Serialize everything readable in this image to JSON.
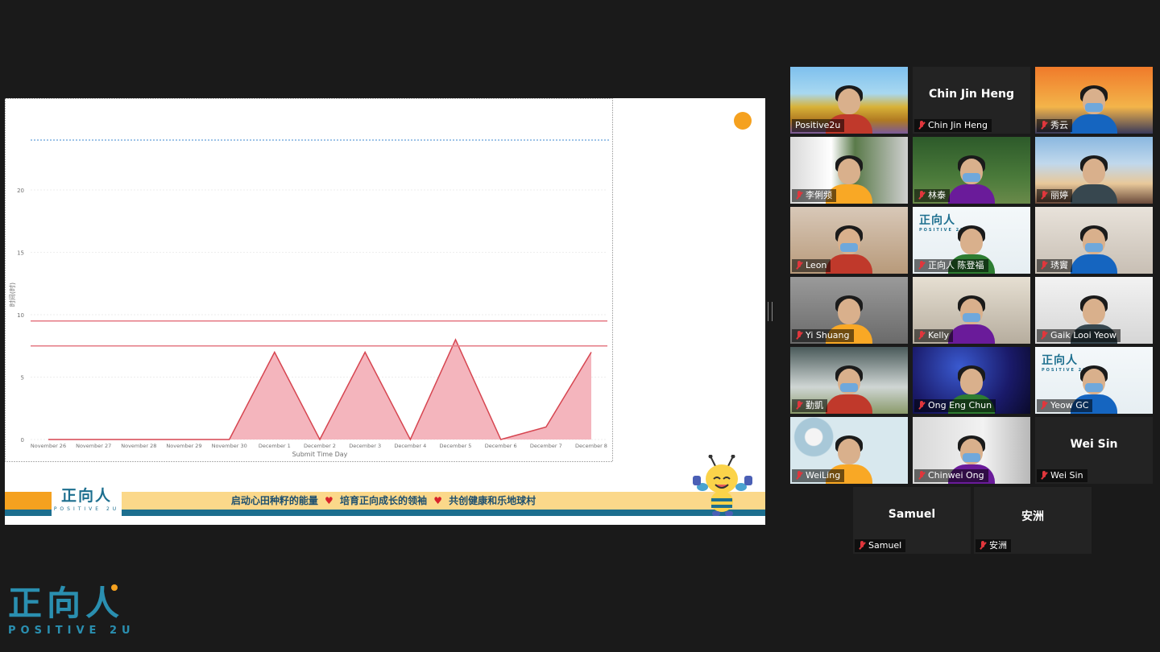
{
  "slide": {
    "banner_logo_zh": "正向人",
    "banner_logo_en": "POSITIVE 2U",
    "banner_phrases": [
      "启动心田种籽的能量",
      "培育正向成长的领袖",
      "共创健康和乐地球村"
    ]
  },
  "chart_data": {
    "type": "area",
    "xlabel": "Submit Time Day",
    "ylabel": "时间(时)",
    "categories": [
      "November 26",
      "November 27",
      "November 28",
      "November 29",
      "November 30",
      "December 1",
      "December 2",
      "December 3",
      "December 4",
      "December 5",
      "December 6",
      "December 7",
      "December 8"
    ],
    "series": [
      {
        "values": [
          0,
          0,
          0,
          0,
          0,
          7,
          0,
          7,
          0,
          8,
          0,
          1,
          7
        ]
      }
    ],
    "yticks": [
      0,
      5,
      10,
      15,
      20
    ],
    "ylim": [
      0,
      24
    ],
    "reference_lines": [
      9.5,
      7.5
    ],
    "top_dashed_line": 24,
    "colors": {
      "area": "#f4b5bd",
      "line": "#d64550",
      "ref": "#e57a84",
      "dashed": "#7fb0e0"
    }
  },
  "corner_logo": {
    "zh": "正向人",
    "en": "POSITIVE 2U"
  },
  "participants": [
    {
      "name": "Positive2u",
      "bigname": "",
      "video": true,
      "active": true,
      "muted": false,
      "bg": "sunflower"
    },
    {
      "name": "Chin Jin Heng",
      "bigname": "Chin Jin Heng",
      "video": false,
      "muted": true
    },
    {
      "name": "秀云",
      "bigname": "",
      "video": true,
      "muted": true,
      "bg": "sunset"
    },
    {
      "name": "李俐频",
      "bigname": "",
      "video": true,
      "muted": true,
      "bg": "plants"
    },
    {
      "name": "林泰",
      "bigname": "",
      "video": true,
      "muted": true,
      "bg": "forest"
    },
    {
      "name": "丽婷",
      "bigname": "",
      "video": true,
      "muted": true,
      "bg": "beach"
    },
    {
      "name": "Leon",
      "bigname": "",
      "video": true,
      "muted": true,
      "bg": "room"
    },
    {
      "name": "正向人 陈登福",
      "bigname": "",
      "video": true,
      "muted": true,
      "bg": "logo"
    },
    {
      "name": "琇竇",
      "bigname": "",
      "video": true,
      "muted": true,
      "bg": "lightroom"
    },
    {
      "name": "Yi Shuang",
      "bigname": "",
      "video": true,
      "muted": true,
      "bg": "grey"
    },
    {
      "name": "Kelly",
      "bigname": "",
      "video": true,
      "muted": true,
      "bg": "office"
    },
    {
      "name": "Gaik Looi Yeow",
      "bigname": "",
      "video": true,
      "muted": true,
      "bg": "white"
    },
    {
      "name": "勤凱",
      "bigname": "",
      "video": true,
      "muted": true,
      "bg": "office2"
    },
    {
      "name": "Ong Eng Chun",
      "bigname": "",
      "video": true,
      "muted": true,
      "bg": "space"
    },
    {
      "name": "Yeow GC",
      "bigname": "",
      "video": true,
      "muted": true,
      "bg": "logo"
    },
    {
      "name": "WeiLing",
      "bigname": "",
      "video": true,
      "muted": true,
      "bg": "flowers"
    },
    {
      "name": "Chinwei Ong",
      "bigname": "",
      "video": true,
      "muted": true,
      "bg": "wall"
    },
    {
      "name": "Wei Sin",
      "bigname": "Wei Sin",
      "video": false,
      "muted": true
    },
    {
      "name": "Samuel",
      "bigname": "Samuel",
      "video": false,
      "muted": true
    },
    {
      "name": "安洲",
      "bigname": "安洲",
      "video": false,
      "muted": true
    }
  ]
}
